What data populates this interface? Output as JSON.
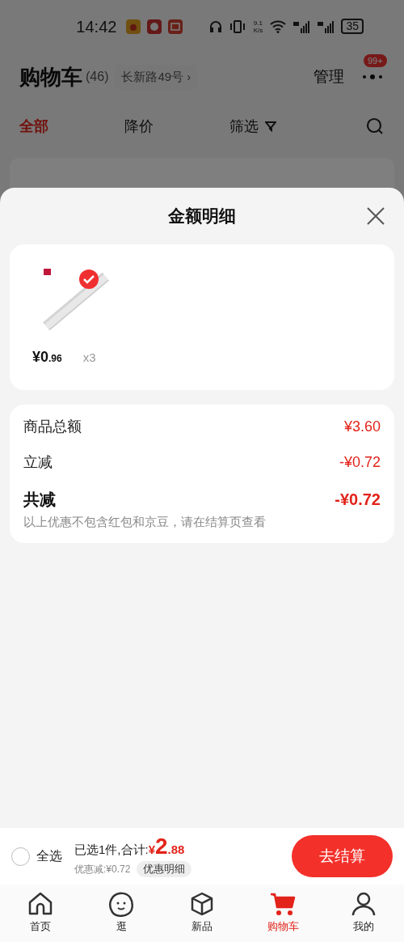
{
  "status_bar": {
    "time": "14:42",
    "net_speed": "9.1 K/s",
    "battery": "35"
  },
  "header": {
    "title": "购物车",
    "count": "(46)",
    "address": "长新路49号 ›",
    "manage": "管理",
    "badge": "99+"
  },
  "filter_tabs": [
    {
      "label": "全部",
      "selected": true
    },
    {
      "label": "降价",
      "selected": false
    },
    {
      "label": "筛选",
      "selected": false
    }
  ],
  "sheet": {
    "title": "金额明细",
    "items": [
      {
        "kind": "picture",
        "price_int": "¥0",
        "price_dec": ".96",
        "qty": "x3",
        "checked": true
      }
    ],
    "rows": [
      {
        "kind": "normal",
        "label": "商品总额",
        "value": "¥3.60"
      },
      {
        "kind": "normal",
        "label": "立减",
        "value": "-¥0.72"
      },
      {
        "kind": "total",
        "label": "共减",
        "value": "-¥0.72",
        "note": "以上优惠不包含红包和京豆，请在结算页查看"
      }
    ]
  },
  "checkout": {
    "select_all": "全选",
    "select_all_checked": false,
    "summary": "已选1件,合计:",
    "currency": "¥",
    "total_int": "2",
    "total_dec": ".88",
    "discount": "优惠减:¥0.72",
    "detail_button": "优惠明细",
    "submit": "去结算"
  },
  "nav": [
    {
      "label": "首页",
      "selected": false
    },
    {
      "label": "逛",
      "selected": false
    },
    {
      "label": "新品",
      "selected": false
    },
    {
      "label": "购物车",
      "selected": true
    },
    {
      "label": "我的",
      "selected": false
    }
  ]
}
